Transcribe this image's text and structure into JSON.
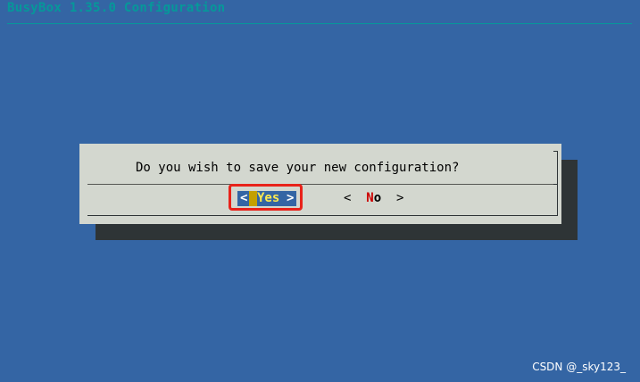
{
  "app": {
    "title": "BusyBox 1.35.0 Configuration"
  },
  "dialog": {
    "question": "Do you wish to save your new configuration?",
    "yes_button": {
      "left_bracket": "<",
      "label": "Yes",
      "right_bracket": ">",
      "selected": true
    },
    "no_button": {
      "left_bracket": "<",
      "hotkey": "N",
      "label_rest": "o",
      "right_bracket": ">",
      "selected": false
    }
  },
  "watermark": {
    "text": "CSDN @_sky123_"
  },
  "colors": {
    "background": "#3465a4",
    "title": "#06989a",
    "dialog": "#d3d7cf",
    "shadow": "#2e3436",
    "selected_label": "#fce94f",
    "hotkey": "#cc0000",
    "annotation": "#e8221a"
  }
}
